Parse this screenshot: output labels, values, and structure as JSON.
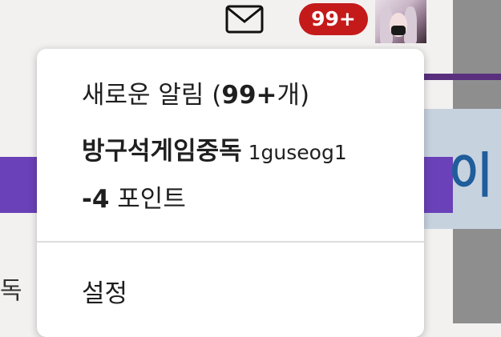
{
  "header": {
    "notification_badge": "99+"
  },
  "background": {
    "left_text": "독"
  },
  "dropdown": {
    "notifications": {
      "prefix": "새로운 알림 (",
      "count": "99+",
      "suffix": "개)"
    },
    "user": {
      "nickname": "방구석게임중독",
      "user_id": "1guseog1"
    },
    "points": {
      "value": "-4",
      "unit": " 포인트"
    },
    "settings_label": "설정"
  },
  "colors": {
    "badge": "#c51a1a",
    "accent_purple": "#6a41b8"
  },
  "icons": [
    "mail-icon",
    "avatar"
  ]
}
